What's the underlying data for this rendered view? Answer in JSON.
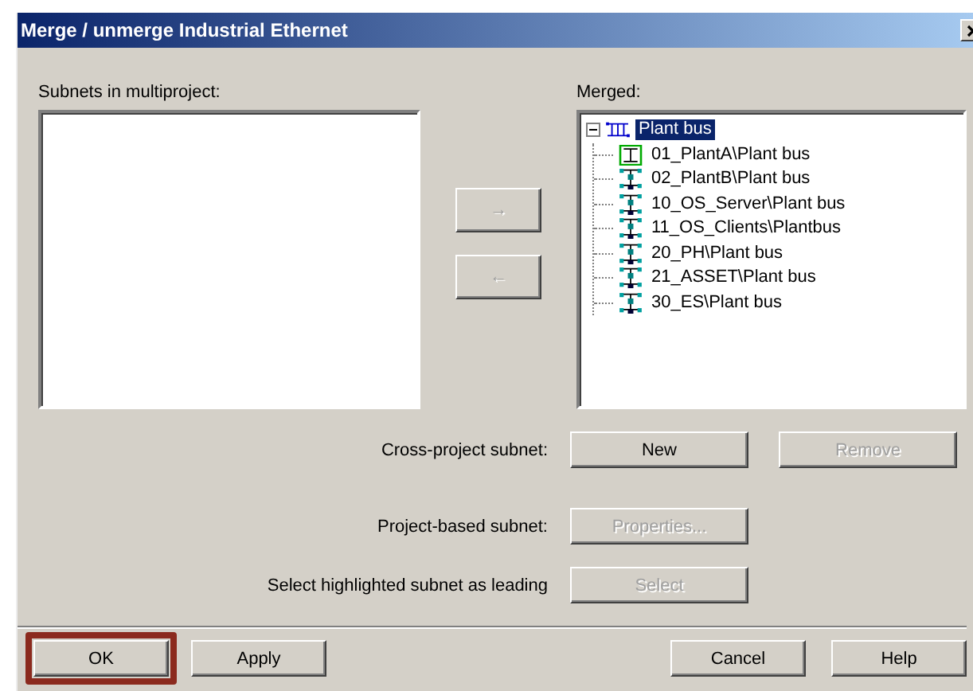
{
  "window": {
    "title": "Merge / unmerge Industrial Ethernet"
  },
  "subnets_list": {
    "label": "Subnets in multiproject:"
  },
  "move_buttons": [
    {
      "label": "→",
      "disabled": true
    },
    {
      "label": "←",
      "disabled": true
    }
  ],
  "merged_tree": {
    "label": "Merged:",
    "items": [
      {
        "label": "Plant bus",
        "kind": "root",
        "selected": true,
        "expanded": true,
        "children": [
          {
            "label": "01_PlantA\\Plant bus",
            "kind": "leading",
            "selected": false
          },
          {
            "label": "02_PlantB\\Plant bus",
            "kind": "subnet",
            "selected": false
          },
          {
            "label": "10_OS_Server\\Plant bus",
            "kind": "subnet",
            "selected": false
          },
          {
            "label": "11_OS_Clients\\Plantbus",
            "kind": "subnet",
            "selected": false
          },
          {
            "label": "20_PH\\Plant bus",
            "kind": "subnet",
            "selected": false
          },
          {
            "label": "21_ASSET\\Plant bus",
            "kind": "subnet",
            "selected": false
          },
          {
            "label": "30_ES\\Plant bus",
            "kind": "subnet",
            "selected": false
          }
        ]
      }
    ]
  },
  "actions": [
    {
      "label": "Cross-project subnet:",
      "buttons": [
        {
          "label": "New",
          "disabled": false
        },
        {
          "label": "Remove",
          "disabled": true
        }
      ]
    },
    {
      "label": "Project-based subnet:",
      "buttons": [
        {
          "label": "Properties...",
          "disabled": true
        }
      ]
    },
    {
      "label": "Select highlighted subnet as leading",
      "buttons": [
        {
          "label": "Select",
          "disabled": true
        }
      ]
    }
  ],
  "footer_left": [
    {
      "label": "OK",
      "highlighted": true
    },
    {
      "label": "Apply",
      "highlighted": false
    }
  ],
  "footer_right": [
    {
      "label": "Cancel",
      "highlighted": false
    },
    {
      "label": "Help",
      "highlighted": false
    }
  ]
}
